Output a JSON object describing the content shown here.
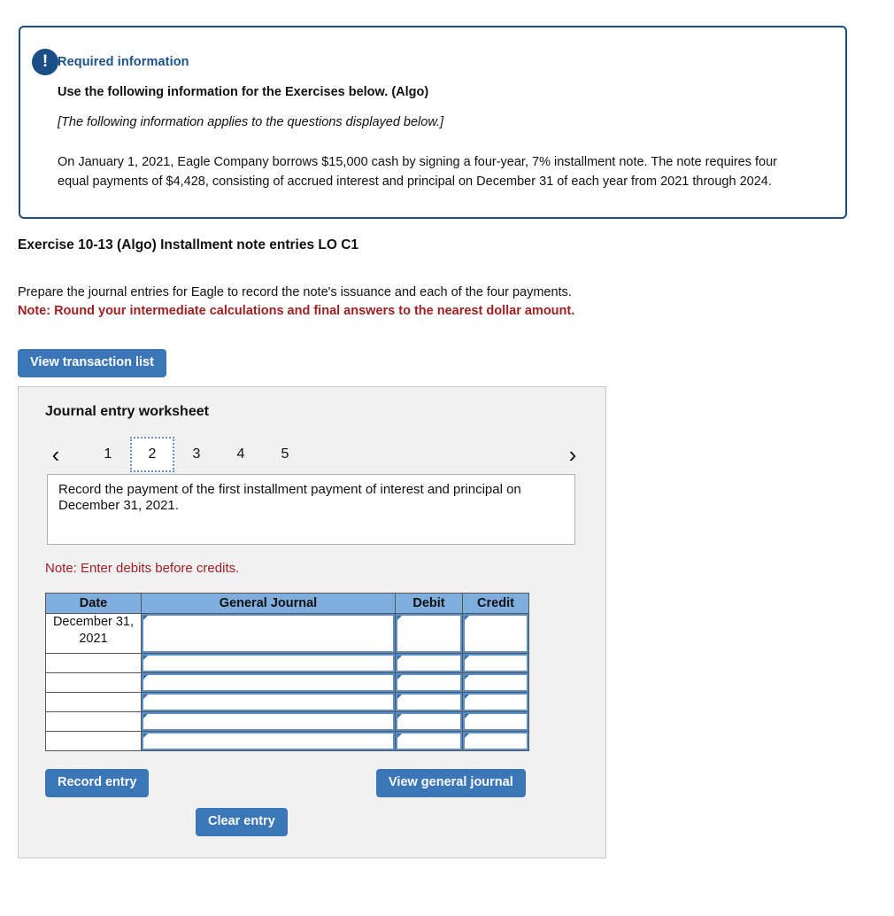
{
  "info_box": {
    "badge_icon": "exclamation-icon",
    "badge_glyph": "!",
    "title": "Required information",
    "subtitle": "Use the following information for the Exercises below. (Algo)",
    "italic_note": "[The following information applies to the questions displayed below.]",
    "paragraph": "On January 1, 2021, Eagle Company borrows $15,000 cash by signing a four-year, 7% installment note. The note requires four equal payments of $4,428, consisting of accrued interest and principal on December 31 of each year from 2021 through 2024.",
    "border_color": "#1b4e87",
    "title_color": "#1b5288"
  },
  "exercise": {
    "title": "Exercise 10-13 (Algo) Installment note entries LO C1",
    "instruction": "Prepare the journal entries for Eagle to record the note's issuance and each of the four payments.",
    "warning": "Note: Round your intermediate calculations and final answers to the nearest dollar amount.",
    "warning_color": "#a01f22",
    "view_transaction_list_label": "View transaction list"
  },
  "worksheet": {
    "title": "Journal entry worksheet",
    "pager": {
      "prev_icon": "chevron-left-icon",
      "prev_glyph": "‹",
      "next_icon": "chevron-right-icon",
      "next_glyph": "›",
      "pages": [
        "1",
        "2",
        "3",
        "4",
        "5"
      ],
      "active_page": "2"
    },
    "transaction_description": "Record the payment of the first installment payment of interest and principal on December 31, 2021.",
    "note_debits": "Note: Enter debits before credits.",
    "table": {
      "headers": [
        "Date",
        "General Journal",
        "Debit",
        "Credit"
      ],
      "rows": [
        {
          "date": "December 31, 2021",
          "general_journal": "",
          "debit": "",
          "credit": ""
        },
        {
          "date": "",
          "general_journal": "",
          "debit": "",
          "credit": ""
        },
        {
          "date": "",
          "general_journal": "",
          "debit": "",
          "credit": ""
        },
        {
          "date": "",
          "general_journal": "",
          "debit": "",
          "credit": ""
        },
        {
          "date": "",
          "general_journal": "",
          "debit": "",
          "credit": ""
        },
        {
          "date": "",
          "general_journal": "",
          "debit": "",
          "credit": ""
        }
      ],
      "header_color": "#7fadde"
    },
    "buttons": {
      "record_entry": "Record entry",
      "clear_entry": "Clear entry",
      "view_general_journal": "View general journal",
      "color": "#3a76b8"
    }
  }
}
